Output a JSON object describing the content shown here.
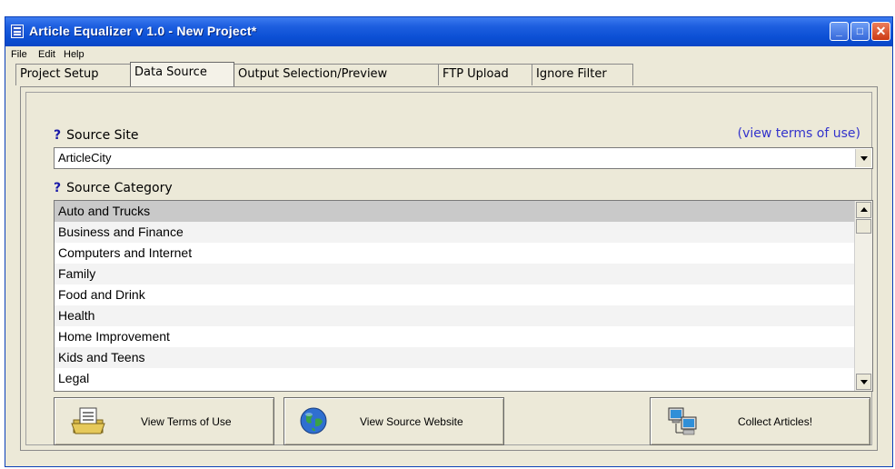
{
  "window": {
    "title": "Article Equalizer v 1.0 - New Project*",
    "controls": {
      "minimize": "_",
      "maximize": "□",
      "close": "✕"
    }
  },
  "menu": [
    "File",
    "Edit",
    "Help"
  ],
  "tabs": [
    {
      "label": "Project Setup",
      "active": false
    },
    {
      "label": "Data Source",
      "active": true
    },
    {
      "label": "Output Selection/Preview",
      "active": false
    },
    {
      "label": "FTP Upload",
      "active": false
    },
    {
      "label": "Ignore Filter",
      "active": false
    }
  ],
  "source_site": {
    "help_icon": "?",
    "label": "Source Site",
    "terms_link": "(view terms of use)",
    "selected": "ArticleCity"
  },
  "source_category": {
    "help_icon": "?",
    "label": "Source Category",
    "items": [
      "Auto and Trucks",
      "Business and Finance",
      "Computers and Internet",
      "Family",
      "Food and Drink",
      "Health",
      "Home Improvement",
      "Kids and Teens",
      "Legal"
    ],
    "selected_index": 0
  },
  "buttons": {
    "view_terms": "View Terms of Use",
    "view_source": "View Source Website",
    "collect": "Collect Articles!"
  },
  "icons": {
    "app": "app-icon",
    "help": "question-mark-icon",
    "terms": "document-folder-icon",
    "source": "globe-icon",
    "collect": "computer-network-icon"
  }
}
